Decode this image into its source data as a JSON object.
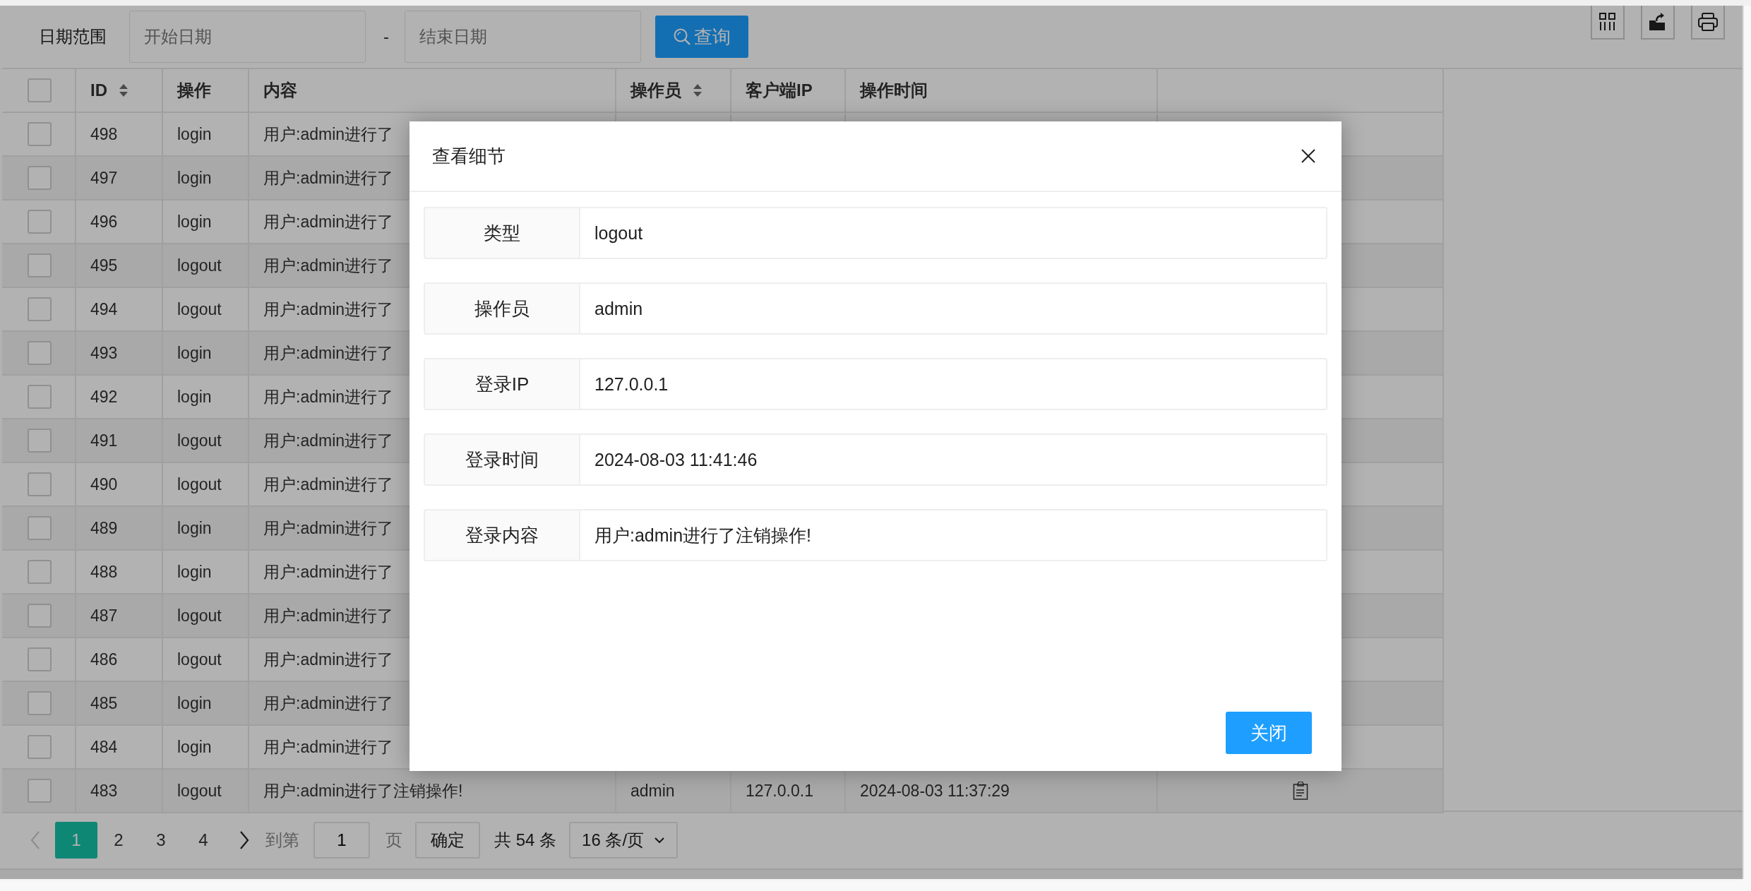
{
  "toolbar": {
    "label": "日期范围",
    "start_date": {
      "placeholder": "开始日期"
    },
    "separator": "-",
    "end_date": {
      "placeholder": "结束日期"
    },
    "query_button": "查询"
  },
  "table": {
    "select_all": {
      "checked": false
    },
    "columns": [
      {
        "label": "ID",
        "sortable": true
      },
      {
        "label": "操作",
        "sortable": false
      },
      {
        "label": "内容",
        "sortable": false
      },
      {
        "label": "操作员",
        "sortable": true
      },
      {
        "label": "客户端IP",
        "sortable": false
      },
      {
        "label": "操作时间",
        "sortable": false
      }
    ],
    "rows": [
      {
        "checked": false,
        "id": "498",
        "action": "login",
        "content": "用户:admin进行了"
      },
      {
        "checked": false,
        "id": "497",
        "action": "login",
        "content": "用户:admin进行了"
      },
      {
        "checked": false,
        "id": "496",
        "action": "login",
        "content": "用户:admin进行了"
      },
      {
        "checked": false,
        "id": "495",
        "action": "logout",
        "content": "用户:admin进行了"
      },
      {
        "checked": false,
        "id": "494",
        "action": "logout",
        "content": "用户:admin进行了"
      },
      {
        "checked": false,
        "id": "493",
        "action": "login",
        "content": "用户:admin进行了"
      },
      {
        "checked": false,
        "id": "492",
        "action": "login",
        "content": "用户:admin进行了"
      },
      {
        "checked": false,
        "id": "491",
        "action": "logout",
        "content": "用户:admin进行了"
      },
      {
        "checked": false,
        "id": "490",
        "action": "logout",
        "content": "用户:admin进行了"
      },
      {
        "checked": false,
        "id": "489",
        "action": "login",
        "content": "用户:admin进行了"
      },
      {
        "checked": false,
        "id": "488",
        "action": "login",
        "content": "用户:admin进行了"
      },
      {
        "checked": false,
        "id": "487",
        "action": "logout",
        "content": "用户:admin进行了"
      },
      {
        "checked": false,
        "id": "486",
        "action": "logout",
        "content": "用户:admin进行了"
      },
      {
        "checked": false,
        "id": "485",
        "action": "login",
        "content": "用户:admin进行了"
      },
      {
        "checked": false,
        "id": "484",
        "action": "login",
        "content": "用户:admin进行了"
      },
      {
        "checked": false,
        "id": "483",
        "action": "logout",
        "content": "用户:admin进行了注销操作!",
        "operator": "admin",
        "ip": "127.0.0.1",
        "time": "2024-08-03 11:37:29",
        "detail_icon": true
      }
    ]
  },
  "pagination": {
    "prev_disabled": true,
    "pages": [
      {
        "label": "1",
        "selected": true
      },
      {
        "label": "2",
        "selected": false
      },
      {
        "label": "3",
        "selected": false
      },
      {
        "label": "4",
        "selected": false
      }
    ],
    "goto_label": "到第",
    "page_input": "1",
    "page_suffix": "页",
    "confirm_button": "确定",
    "total": "共 54 条",
    "page_size": "16 条/页"
  },
  "dialog": {
    "title": "查看细节",
    "fields": [
      {
        "label": "类型",
        "value": "logout"
      },
      {
        "label": "操作员",
        "value": "admin"
      },
      {
        "label": "登录IP",
        "value": "127.0.0.1"
      },
      {
        "label": "登录时间",
        "value": "2024-08-03 11:41:46"
      },
      {
        "label": "登录内容",
        "value": "用户:admin进行了注销操作!"
      }
    ],
    "close_button": "关闭"
  }
}
